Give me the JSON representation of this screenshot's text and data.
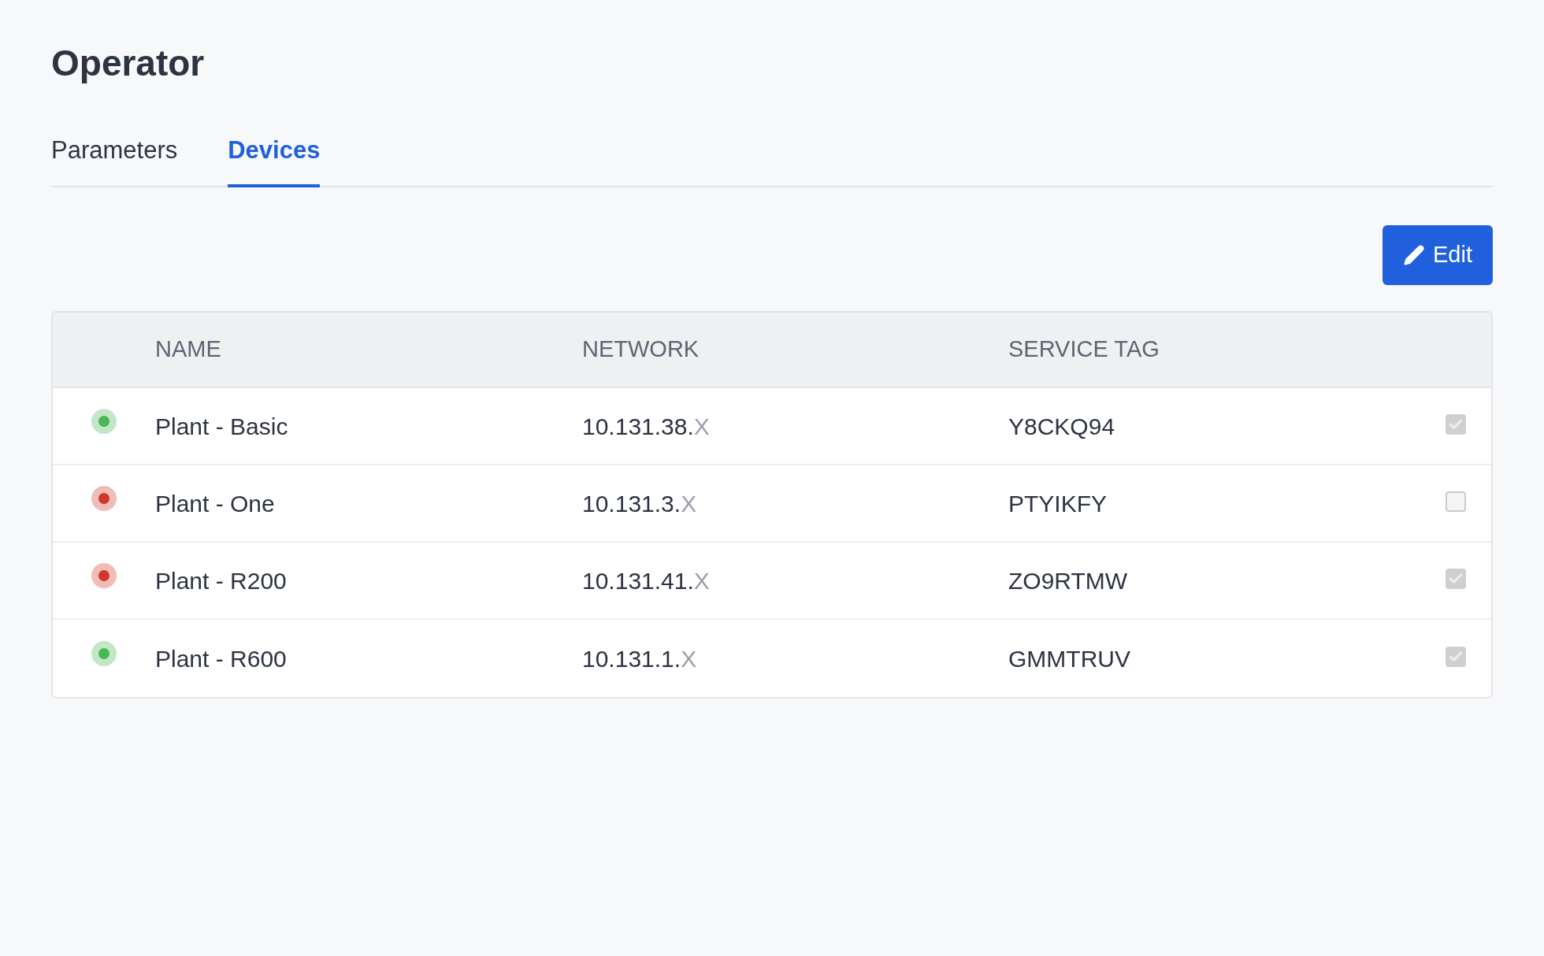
{
  "page": {
    "title": "Operator"
  },
  "tabs": [
    {
      "label": "Parameters",
      "selected": false
    },
    {
      "label": "Devices",
      "selected": true
    }
  ],
  "toolbar": {
    "edit_button": "Edit"
  },
  "table": {
    "columns": [
      "NAME",
      "NETWORK",
      "SERVICE TAG"
    ],
    "rows": [
      {
        "color": "#48b754",
        "name": "Plant - Basic",
        "network_prefix": "10.131.38.",
        "network_suffix": "X",
        "service_tag": "Y8CKQ94",
        "checked": true
      },
      {
        "color": "#d1362b",
        "name": "Plant - One",
        "network_prefix": "10.131.3.",
        "network_suffix": "X",
        "service_tag": "PTYIKFY",
        "checked": false
      },
      {
        "color": "#d1362b",
        "name": "Plant - R200",
        "network_prefix": "10.131.41.",
        "network_suffix": "X",
        "service_tag": "ZO9RTMW",
        "checked": true
      },
      {
        "color": "#48b754",
        "name": "Plant - R600",
        "network_prefix": "10.131.1.",
        "network_suffix": "X",
        "service_tag": "GMMTRUV",
        "checked": true
      }
    ]
  }
}
